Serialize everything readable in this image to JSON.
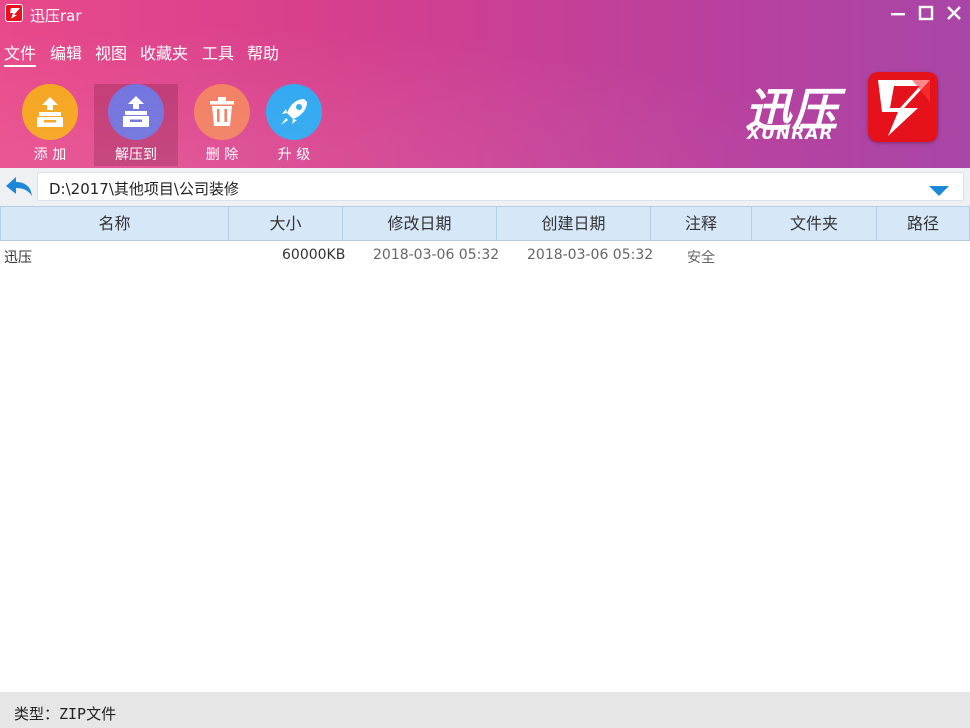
{
  "window": {
    "title": "迅压rar"
  },
  "menu": [
    "文件",
    "编辑",
    "视图",
    "收藏夹",
    "工具",
    "帮助"
  ],
  "toolbar": [
    {
      "label": "添 加",
      "icon": "add-archive-icon",
      "color": "#f39c12",
      "selected": false
    },
    {
      "label": "解压到",
      "icon": "extract-icon",
      "color": "#6c6fd8",
      "selected": true
    },
    {
      "label": "删 除",
      "icon": "trash-icon",
      "color": "#f07a5a",
      "selected": false
    },
    {
      "label": "升 级",
      "icon": "rocket-icon",
      "color": "#29a4ee",
      "selected": false
    }
  ],
  "brand": {
    "name_cn": "迅压",
    "name_en": "XUNRAR",
    "logo_color": "#e5121c"
  },
  "path": {
    "value": "D:\\2017\\其他项目\\公司装修"
  },
  "table": {
    "columns": [
      "名称",
      "大小",
      "修改日期",
      "创建日期",
      "注释",
      "文件夹",
      "路径"
    ],
    "rows": [
      {
        "name": "迅压",
        "size": "60000KB",
        "modified": "2018-03-06 05:32",
        "created": "2018-03-06 05:32",
        "comment": "安全",
        "folder": "",
        "path": ""
      }
    ]
  },
  "status": {
    "text": "类型：ZIP文件"
  },
  "colors": {
    "header_start": "#e8498a",
    "header_end": "#a846a7",
    "column_header_bg": "#d6e7f8",
    "accent_blue": "#1e88d8"
  }
}
